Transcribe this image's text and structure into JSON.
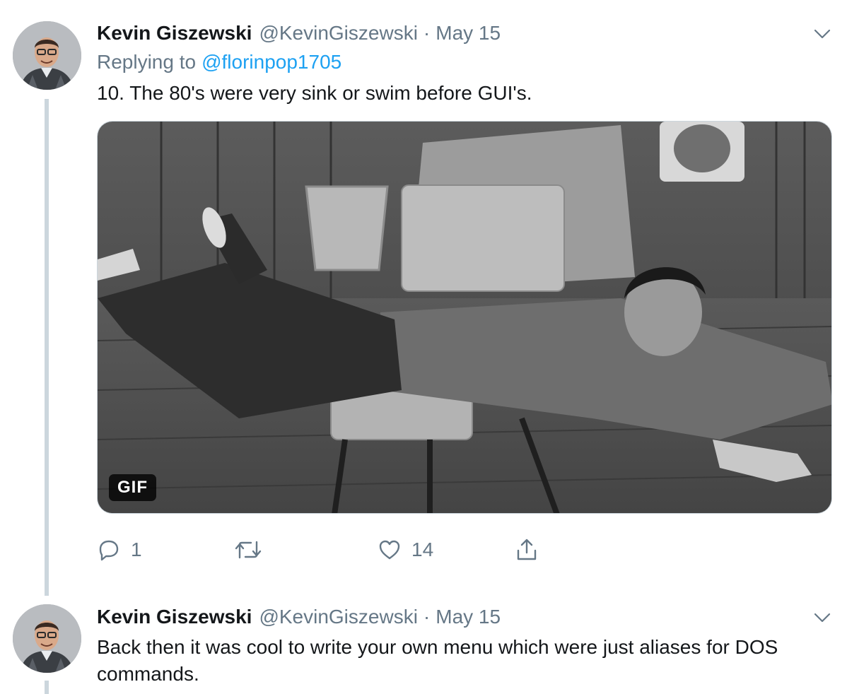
{
  "tweets": [
    {
      "author_name": "Kevin Giszewski",
      "handle": "@KevinGiszewski",
      "separator": "·",
      "date": "May 15",
      "replying_label": "Replying to",
      "replying_to": "@florinpop1705",
      "text": "10. The 80's were very sink or swim before GUI's.",
      "media": {
        "type": "gif",
        "badge": "GIF"
      },
      "actions": {
        "reply": {
          "icon": "reply-icon",
          "count": "1"
        },
        "retweet": {
          "icon": "retweet-icon",
          "count": ""
        },
        "like": {
          "icon": "heart-icon",
          "count": "14"
        },
        "share": {
          "icon": "share-icon"
        }
      }
    },
    {
      "author_name": "Kevin Giszewski",
      "handle": "@KevinGiszewski",
      "separator": "·",
      "date": "May 15",
      "text": "Back then it was cool to write your own menu which were just aliases for DOS commands."
    }
  ],
  "colors": {
    "link": "#1da1f2",
    "secondary_text": "#657786",
    "primary_text": "#14171a",
    "thread_line": "#ccd6dd"
  }
}
